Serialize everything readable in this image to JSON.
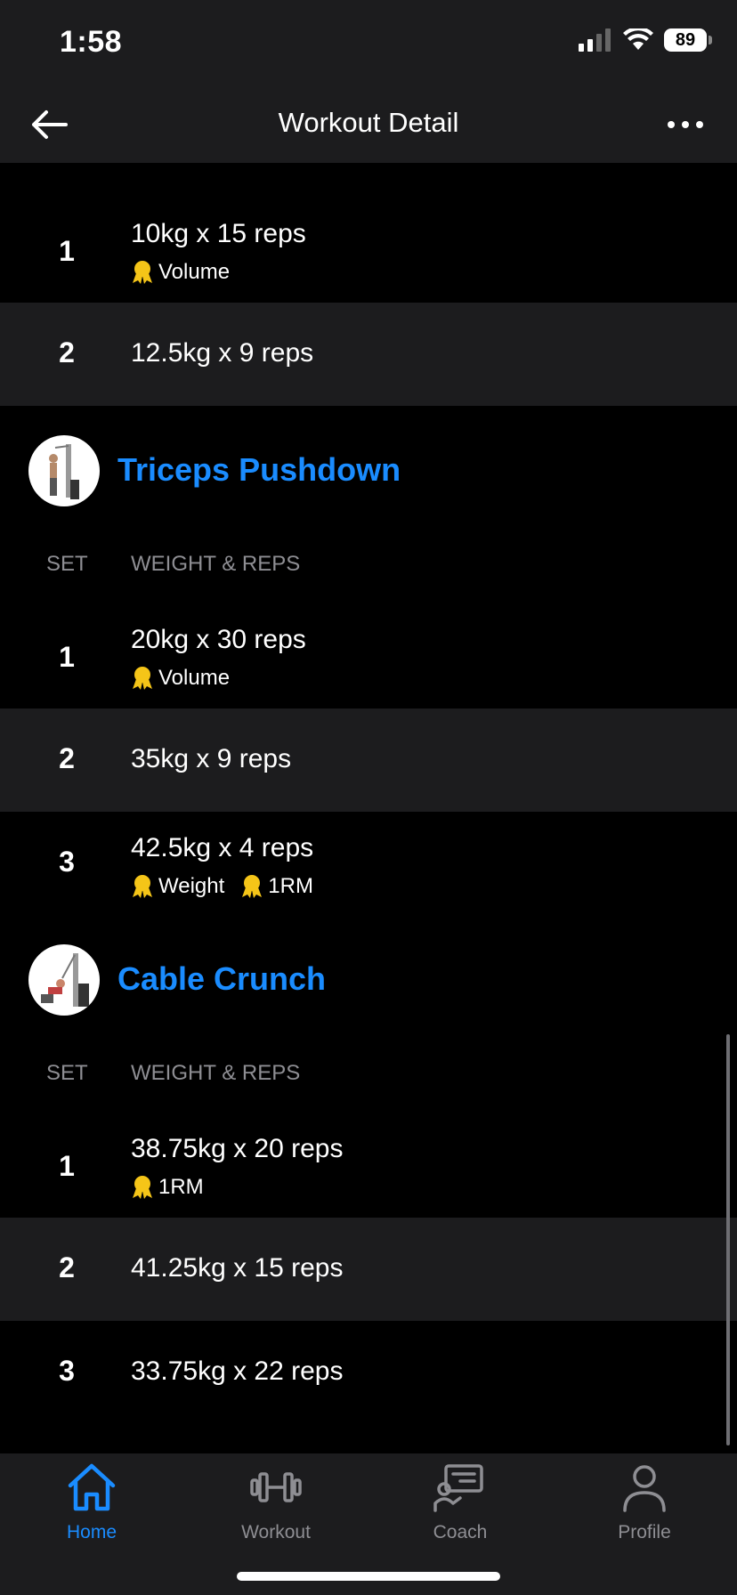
{
  "status": {
    "time": "1:58",
    "battery": "89"
  },
  "header": {
    "title": "Workout Detail"
  },
  "partial_exercise": {
    "sets": [
      {
        "num": "1",
        "value": "10kg x 15 reps",
        "badges": [
          "Volume"
        ]
      },
      {
        "num": "2",
        "value": "12.5kg x 9 reps",
        "badges": []
      }
    ]
  },
  "columns": {
    "set": "SET",
    "weight_reps": "WEIGHT & REPS"
  },
  "exercises": [
    {
      "name": "Triceps Pushdown",
      "sets": [
        {
          "num": "1",
          "value": "20kg x 30 reps",
          "badges": [
            "Volume"
          ]
        },
        {
          "num": "2",
          "value": "35kg x 9 reps",
          "badges": []
        },
        {
          "num": "3",
          "value": "42.5kg x 4 reps",
          "badges": [
            "Weight",
            "1RM"
          ]
        }
      ]
    },
    {
      "name": "Cable Crunch",
      "sets": [
        {
          "num": "1",
          "value": "38.75kg x 20 reps",
          "badges": [
            "1RM"
          ]
        },
        {
          "num": "2",
          "value": "41.25kg x 15 reps",
          "badges": []
        },
        {
          "num": "3",
          "value": "33.75kg x 22 reps",
          "badges": []
        }
      ]
    }
  ],
  "tabs": [
    {
      "label": "Home",
      "icon": "home-icon",
      "active": true
    },
    {
      "label": "Workout",
      "icon": "dumbbell-icon",
      "active": false
    },
    {
      "label": "Coach",
      "icon": "coach-icon",
      "active": false
    },
    {
      "label": "Profile",
      "icon": "profile-icon",
      "active": false
    }
  ],
  "colors": {
    "accent": "#1a8cff",
    "medal": "#f5c518",
    "row_alt": "#1c1c1e"
  }
}
